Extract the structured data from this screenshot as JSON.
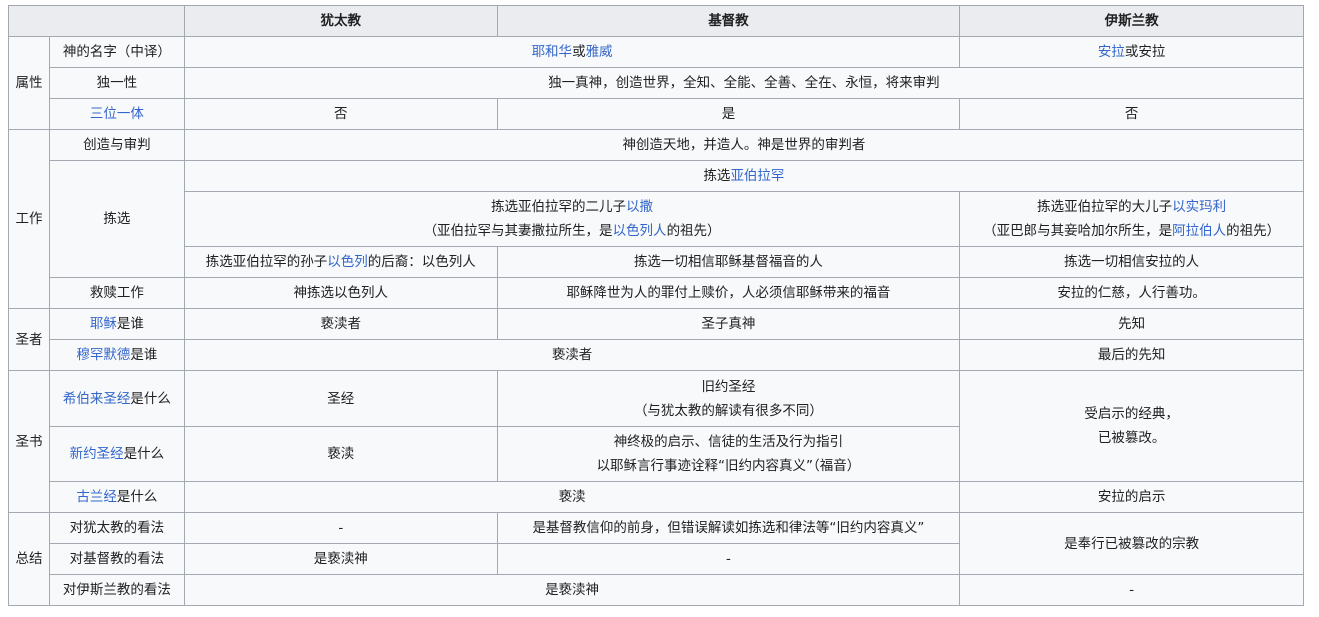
{
  "header": {
    "judaism": "犹太教",
    "christianity": "基督教",
    "islam": "伊斯兰教"
  },
  "groups": {
    "attributes": "属性",
    "works": "工作",
    "prophets": "圣者",
    "scripture": "圣书",
    "summary": "总结"
  },
  "rows": {
    "god_name": {
      "label": "神的名字（中译）",
      "jc_link1": "耶和华",
      "jc_sep": "或",
      "jc_link2": "雅威",
      "islam_link": "安拉",
      "islam_rest": "或安拉"
    },
    "oneness": {
      "label": "独一性",
      "all": "独一真神，创造世界，全知、全能、全善、全在、永恒，将来审判"
    },
    "trinity": {
      "label": "三位一体",
      "judaism": "否",
      "christianity": "是",
      "islam": "否"
    },
    "creation": {
      "label": "创造与审判",
      "all": "神创造天地，并造人。神是世界的审判者"
    },
    "election": {
      "label": "拣选",
      "top_pre": "拣选",
      "top_link": "亚伯拉罕",
      "jc_l1_pre": "拣选亚伯拉罕的二儿子",
      "jc_l1_link": "以撒",
      "jc_l2_pre": "（亚伯拉罕与其妻撒拉所生，是",
      "jc_l2_link": "以色列人",
      "jc_l2_post": "的祖先）",
      "is_l1_pre": "拣选亚伯拉罕的大儿子",
      "is_l1_link": "以实玛利",
      "is_l2_pre": "（亚巴郎与其妾哈加尔所生，是",
      "is_l2_link": "阿拉伯人",
      "is_l2_post": "的祖先）",
      "j_pre": "拣选亚伯拉罕的孙子",
      "j_link": "以色列",
      "j_post": "的后裔：以色列人",
      "christianity": "拣选一切相信耶稣基督福音的人",
      "islam": "拣选一切相信安拉的人"
    },
    "salvation": {
      "label": "救赎工作",
      "judaism": "神拣选以色列人",
      "christianity": "耶稣降世为人的罪付上赎价，人必须信耶稣带来的福音",
      "islam": "安拉的仁慈，人行善功。"
    },
    "jesus": {
      "label_link": "耶稣",
      "label_rest": "是谁",
      "judaism": "亵渎者",
      "christianity": "圣子真神",
      "islam": "先知"
    },
    "muhammad": {
      "label_link": "穆罕默德",
      "label_rest": "是谁",
      "jc": "亵渎者",
      "islam": "最后的先知"
    },
    "hebrew_bible": {
      "label_link": "希伯来圣经",
      "label_rest": "是什么",
      "judaism": "圣经",
      "christianity_l1": "旧约圣经",
      "christianity_l2": "（与犹太教的解读有很多不同）"
    },
    "new_testament": {
      "label_link": "新约圣经",
      "label_rest": "是什么",
      "judaism": "亵渎",
      "christianity_l1": "神终极的启示、信徒的生活及行为指引",
      "christianity_l2": "以耶稣言行事迹诠释“旧约内容真义”（福音）"
    },
    "bible_islam": {
      "l1": "受启示的经典，",
      "l2": "已被篡改。"
    },
    "quran": {
      "label_link": "古兰经",
      "label_rest": "是什么",
      "jc": "亵渎",
      "islam": "安拉的启示"
    },
    "view_judaism": {
      "label": "对犹太教的看法",
      "judaism": "-",
      "christianity": "是基督教信仰的前身，但错误解读如拣选和律法等“旧约内容真义”"
    },
    "view_christianity": {
      "label": "对基督教的看法",
      "judaism": "是亵渎神",
      "christianity": "-"
    },
    "view_islam_merged": "是奉行已被篡改的宗教",
    "view_islam": {
      "label": "对伊斯兰教的看法",
      "jc": "是亵渎神",
      "islam": "-"
    }
  }
}
